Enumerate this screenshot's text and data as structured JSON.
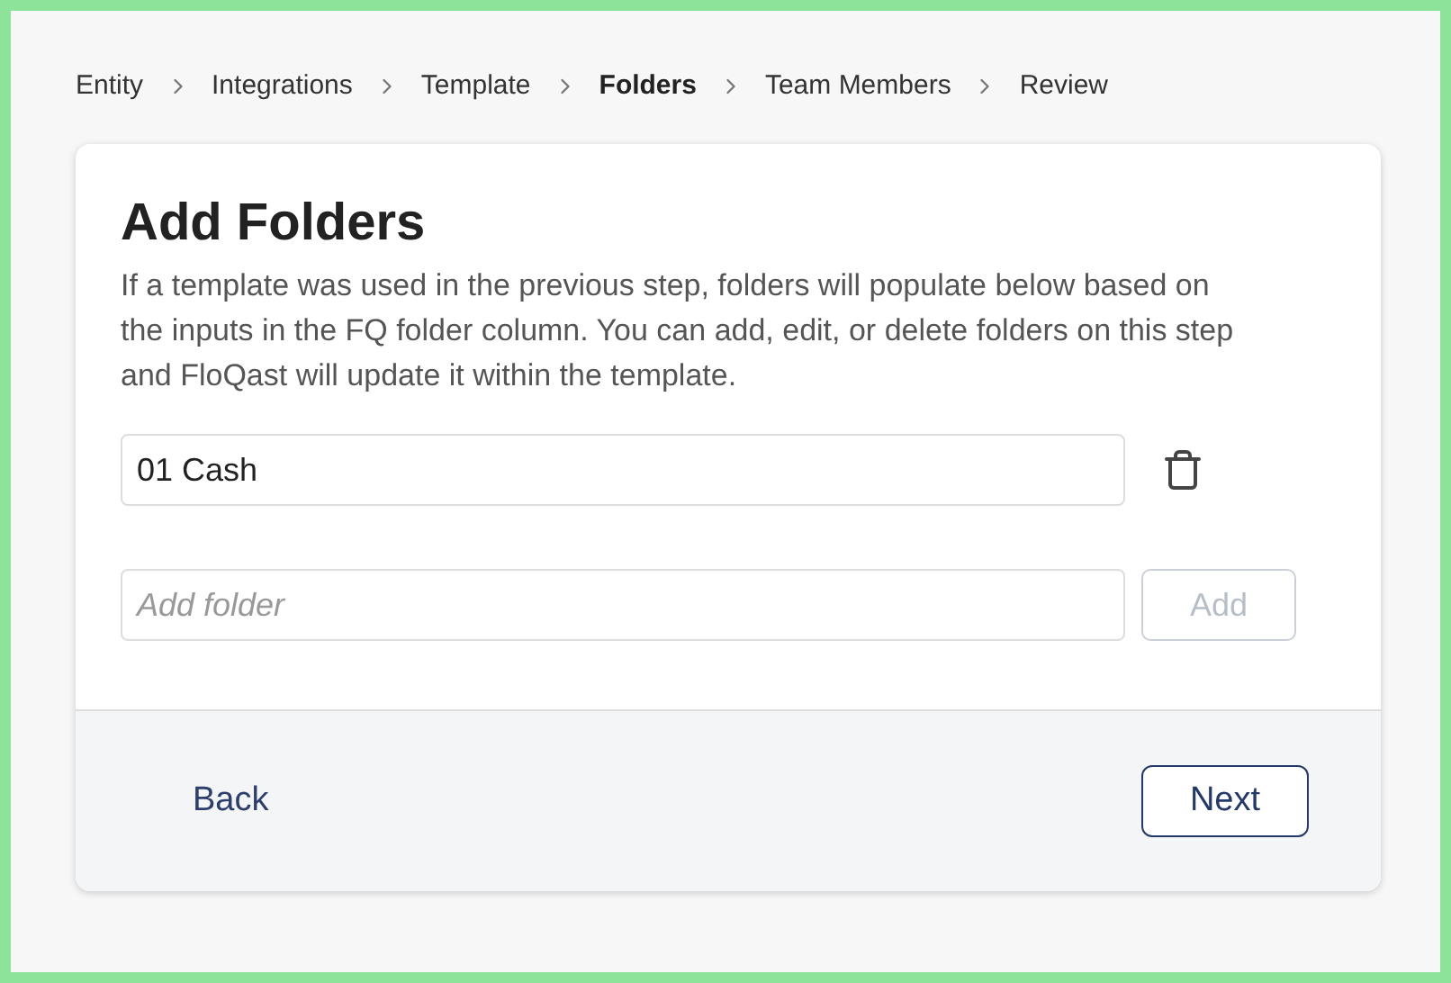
{
  "breadcrumbs": [
    {
      "label": "Entity",
      "selected": false
    },
    {
      "label": "Integrations",
      "selected": false
    },
    {
      "label": "Template",
      "selected": false
    },
    {
      "label": "Folders",
      "selected": true
    },
    {
      "label": "Team Members",
      "selected": false
    },
    {
      "label": "Review",
      "selected": false
    }
  ],
  "title": "Add Folders",
  "description": "If a template was used in the previous step, folders will populate below based on the inputs in the FQ folder column. You can add, edit, or delete folders on this step and FloQast will update it within the template.",
  "folders": [
    {
      "value": "01 Cash"
    }
  ],
  "new_folder": {
    "placeholder": "Add folder"
  },
  "add_button": {
    "label": "Add",
    "disabled": true
  },
  "footer": {
    "back": "Back",
    "next": "Next"
  }
}
